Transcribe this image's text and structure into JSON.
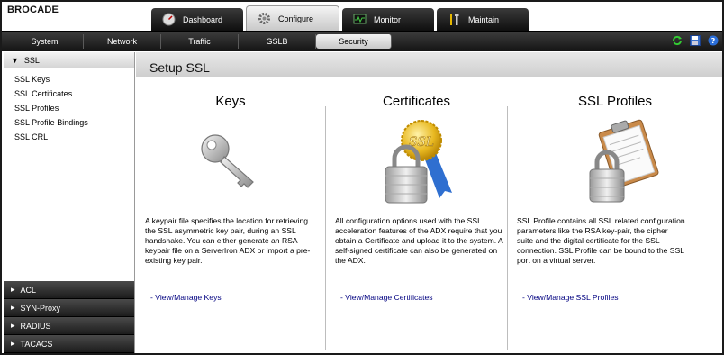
{
  "brand": "BROCADE",
  "main_tabs": [
    {
      "label": "Dashboard",
      "icon": "dashboard-icon"
    },
    {
      "label": "Configure",
      "icon": "gear-icon"
    },
    {
      "label": "Monitor",
      "icon": "monitor-icon"
    },
    {
      "label": "Maintain",
      "icon": "tools-icon"
    }
  ],
  "active_main_tab": "Configure",
  "sub_tabs": [
    "System",
    "Network",
    "Traffic",
    "GSLB",
    "Security"
  ],
  "active_sub_tab": "Security",
  "toolbar_icons": [
    "refresh-icon",
    "save-icon",
    "help-icon"
  ],
  "sidebar": {
    "open_section": "SSL",
    "items": [
      "SSL Keys",
      "SSL Certificates",
      "SSL Profiles",
      "SSL Profile Bindings",
      "SSL CRL"
    ],
    "collapsed_sections": [
      "ACL",
      "SYN-Proxy",
      "RADIUS",
      "TACACS"
    ]
  },
  "page_title": "Setup SSL",
  "columns": [
    {
      "title": "Keys",
      "image": "key-icon",
      "description": "A keypair file specifies the location for retrieving the SSL asymmetric key pair, during an SSL handshake. You can either generate an RSA keypair file on a ServerIron ADX or import a pre-existing key pair.",
      "link": "- View/Manage Keys"
    },
    {
      "title": "Certificates",
      "image": "certificate-lock-icon",
      "description": "All configuration options used with the SSL acceleration features of the ADX require that you obtain a Certificate and upload it to the system. A self-signed certificate can also be generated on the ADX.",
      "link": "- View/Manage Certificates"
    },
    {
      "title": "SSL Profiles",
      "image": "clipboard-lock-icon",
      "description": "SSL Profile contains all SSL related configuration parameters like the RSA key-pair, the cipher suite and the digital certificate for the SSL connection. SSL Profile can be bound to the SSL port on a virtual server.",
      "link": "- View/Manage SSL Profiles"
    }
  ],
  "cert_seal_text": "SSL"
}
